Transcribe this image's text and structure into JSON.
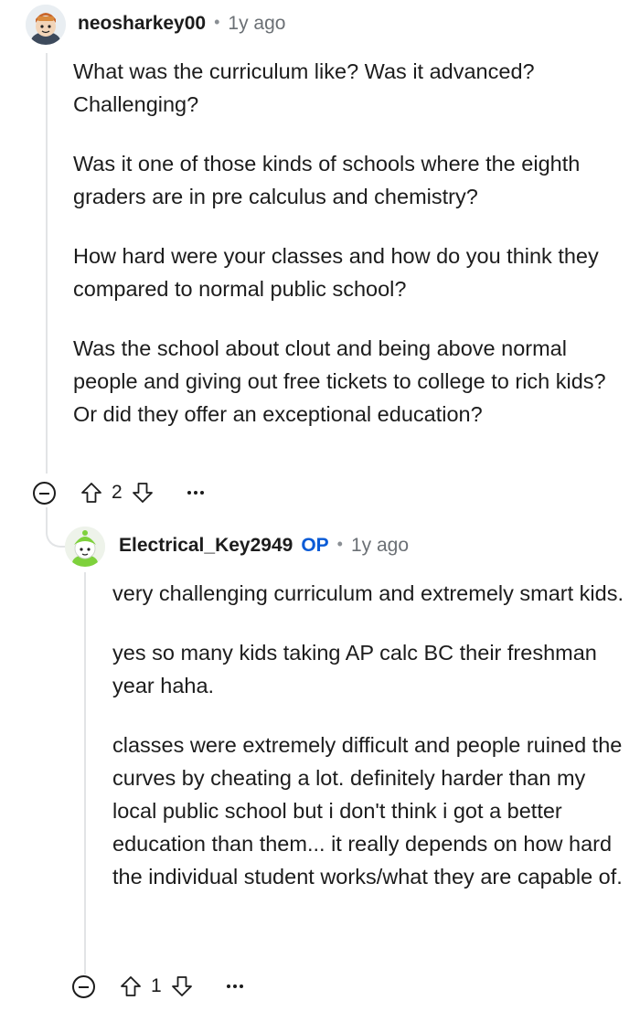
{
  "comments": [
    {
      "username": "neosharkey00",
      "separator": "•",
      "age": "1y ago",
      "paragraphs": [
        "What was the curriculum like? Was it advanced? Challenging?",
        "Was it one of those kinds of schools where the eighth graders are in pre calculus and chemistry?",
        "How hard were your classes and how do you think they compared to normal public school?",
        "Was the school about clout and being above normal people and giving out free tickets to college to rich kids? Or did they offer an exceptional education?"
      ],
      "score": "2"
    },
    {
      "username": "Electrical_Key2949",
      "badge": "OP",
      "separator": "•",
      "age": "1y ago",
      "paragraphs": [
        "very challenging curriculum and extremely smart kids.",
        "yes so many kids taking AP calc BC their freshman year haha.",
        "classes were extremely difficult and people ruined the curves by cheating a lot. definitely harder than my local public school but i don't think i got a better education than them... it really depends on how hard the individual student works/what they are capable of."
      ],
      "score": "1"
    }
  ],
  "colors": {
    "op_badge": "#0a5bd6",
    "thread_line": "#e2e4e6",
    "meta_text": "#6b7075"
  },
  "icons": [
    "collapse-icon",
    "upvote-icon",
    "downvote-icon",
    "more-options-icon",
    "avatar"
  ]
}
